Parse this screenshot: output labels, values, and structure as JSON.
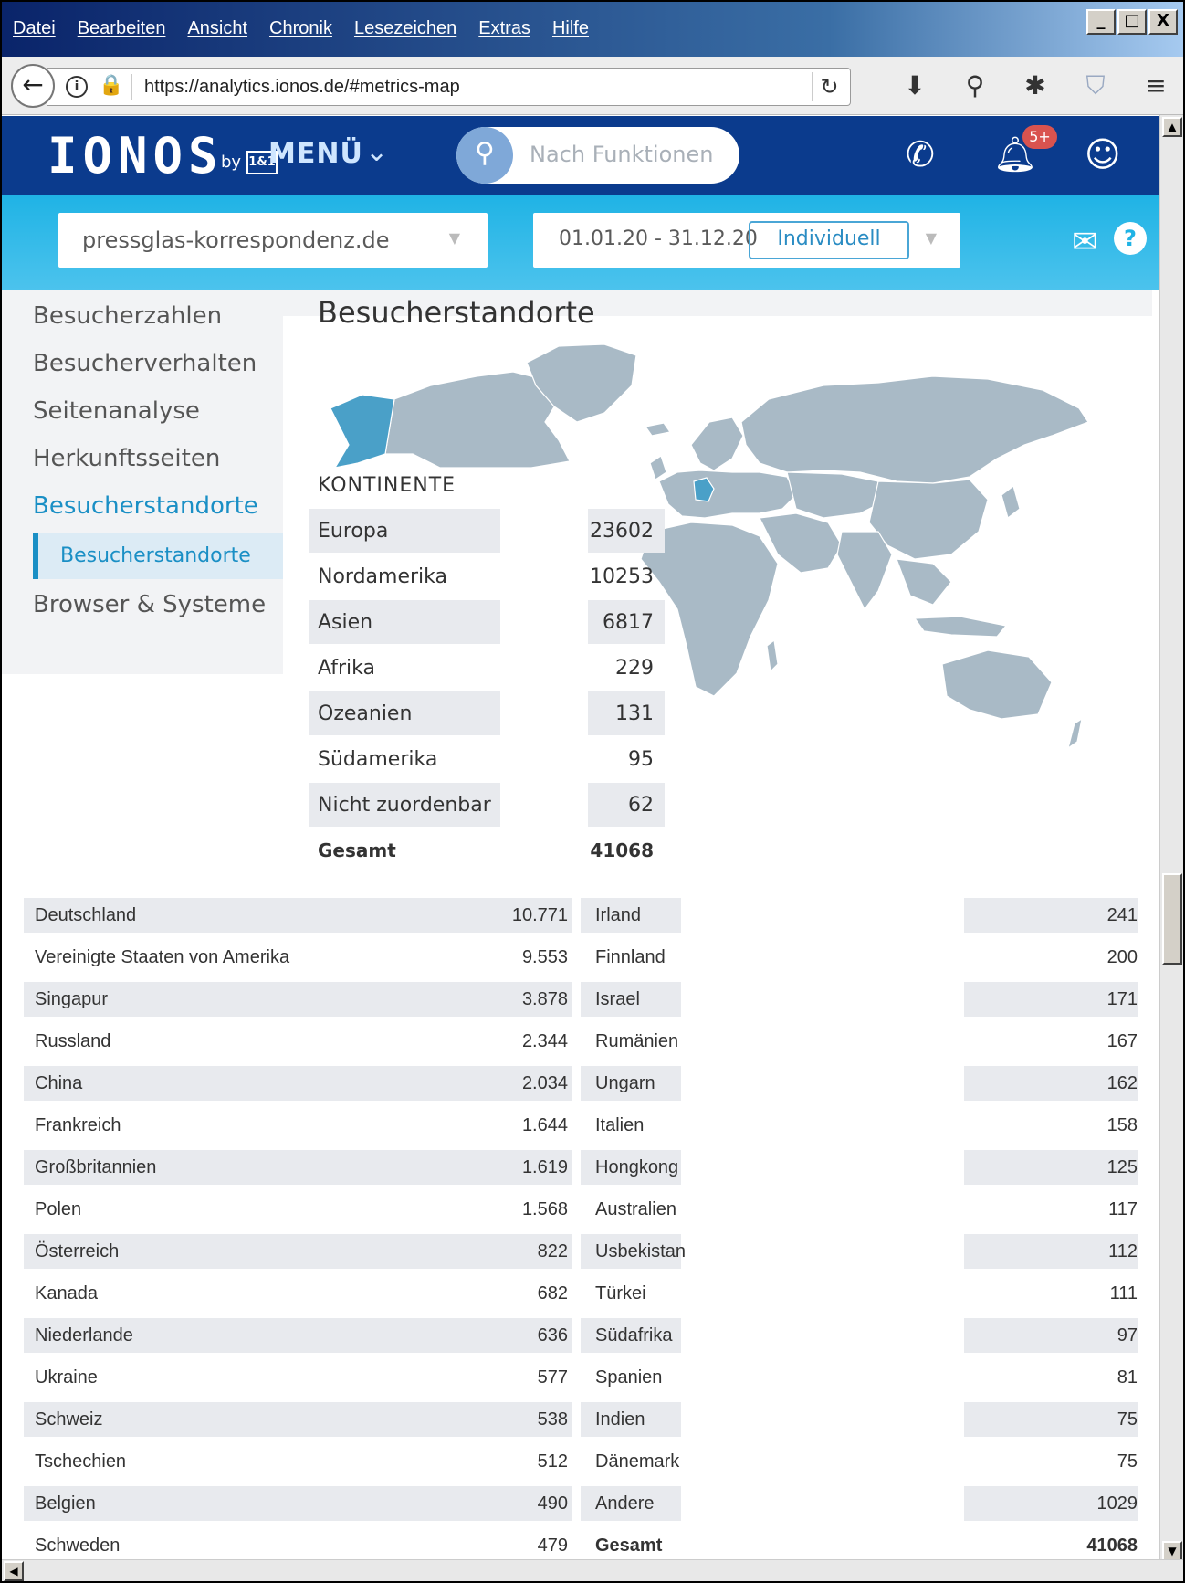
{
  "browser": {
    "menu": [
      "Datei",
      "Bearbeiten",
      "Ansicht",
      "Chronik",
      "Lesezeichen",
      "Extras",
      "Hilfe"
    ],
    "window_buttons": [
      "_",
      "□",
      "X"
    ],
    "url": "https://analytics.ionos.de/#metrics-map",
    "icons": [
      "back-icon",
      "info-icon",
      "lock-icon",
      "reload-icon",
      "download-icon",
      "search-icon",
      "gear-icon",
      "shield-icon",
      "hamburger-icon"
    ]
  },
  "header": {
    "logo": "IONOS",
    "logo_by": "by",
    "logo_brand": "1&1",
    "menu_label": "MENÜ",
    "search_placeholder": "Nach Funktionen",
    "notification_badge": "5+"
  },
  "filters": {
    "domain": "pressglas-korrespondenz.de",
    "date_range": "01.01.20 - 31.12.20",
    "period_button": "Individuell"
  },
  "sidebar": {
    "items": [
      {
        "label": "Besucherzahlen",
        "active": false
      },
      {
        "label": "Besucherverhalten",
        "active": false
      },
      {
        "label": "Seitenanalyse",
        "active": false
      },
      {
        "label": "Herkunftsseiten",
        "active": false
      },
      {
        "label": "Besucherstandorte",
        "active": true
      }
    ],
    "sub_item": "Besucherstandorte",
    "last_item": "Browser & Systeme"
  },
  "main": {
    "title": "Besucherstandorte",
    "continents_title": "KONTINENTE",
    "continents": [
      {
        "name": "Europa",
        "value": "23602"
      },
      {
        "name": "Nordamerika",
        "value": "10253"
      },
      {
        "name": "Asien",
        "value": "6817"
      },
      {
        "name": "Afrika",
        "value": "229"
      },
      {
        "name": "Ozeanien",
        "value": "131"
      },
      {
        "name": "Südamerika",
        "value": "95"
      },
      {
        "name": "Nicht zuordenbar",
        "value": "62"
      }
    ],
    "continents_total_label": "Gesamt",
    "continents_total": "41068",
    "countries_left": [
      {
        "name": "Deutschland",
        "value": "10.771"
      },
      {
        "name": "Vereinigte Staaten von Amerika",
        "value": "9.553"
      },
      {
        "name": "Singapur",
        "value": "3.878"
      },
      {
        "name": "Russland",
        "value": "2.344"
      },
      {
        "name": "China",
        "value": "2.034"
      },
      {
        "name": "Frankreich",
        "value": "1.644"
      },
      {
        "name": "Großbritannien",
        "value": "1.619"
      },
      {
        "name": "Polen",
        "value": "1.568"
      },
      {
        "name": "Österreich",
        "value": "822"
      },
      {
        "name": "Kanada",
        "value": "682"
      },
      {
        "name": "Niederlande",
        "value": "636"
      },
      {
        "name": "Ukraine",
        "value": "577"
      },
      {
        "name": "Schweiz",
        "value": "538"
      },
      {
        "name": "Tschechien",
        "value": "512"
      },
      {
        "name": "Belgien",
        "value": "490"
      },
      {
        "name": "Schweden",
        "value": "479"
      }
    ],
    "countries_right": [
      {
        "name": "Irland",
        "value": "241"
      },
      {
        "name": "Finnland",
        "value": "200"
      },
      {
        "name": "Israel",
        "value": "171"
      },
      {
        "name": "Rumänien",
        "value": "167"
      },
      {
        "name": "Ungarn",
        "value": "162"
      },
      {
        "name": "Italien",
        "value": "158"
      },
      {
        "name": "Hongkong",
        "value": "125"
      },
      {
        "name": "Australien",
        "value": "117"
      },
      {
        "name": "Usbekistan",
        "value": "112"
      },
      {
        "name": "Türkei",
        "value": "111"
      },
      {
        "name": "Südafrika",
        "value": "97"
      },
      {
        "name": "Spanien",
        "value": "81"
      },
      {
        "name": "Indien",
        "value": "75"
      },
      {
        "name": "Dänemark",
        "value": "75"
      },
      {
        "name": "Andere",
        "value": "1029"
      },
      {
        "name": "Gesamt",
        "value": "41068",
        "bold": true
      }
    ]
  },
  "colors": {
    "header_blue": "#0b3b8d",
    "subbar_cyan": "#1fb3e5",
    "accent": "#1a8fc5",
    "map_land": "#a9bac6",
    "map_highlight": "#4aa0c8"
  }
}
